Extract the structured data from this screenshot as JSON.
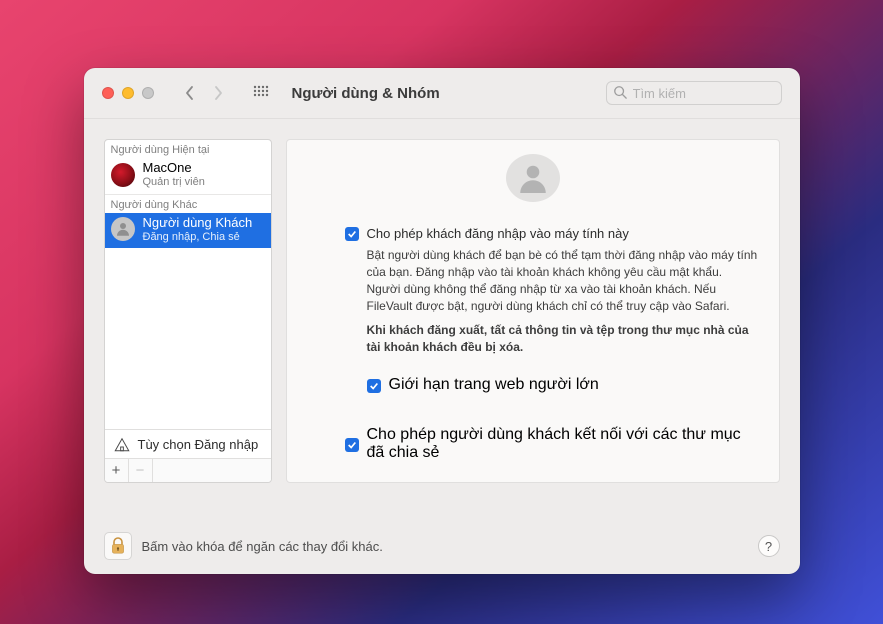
{
  "titlebar": {
    "title": "Người dùng & Nhóm",
    "search_placeholder": "Tìm kiếm"
  },
  "sidebar": {
    "section_current": "Người dùng Hiện tại",
    "section_other": "Người dùng Khác",
    "current_user": {
      "name": "MacOne",
      "role": "Quản trị viên"
    },
    "guest_user": {
      "name": "Người dùng Khách",
      "role": "Đăng nhập, Chia sẻ"
    },
    "login_options": "Tùy chọn Đăng nhập",
    "add": "+",
    "remove": "−"
  },
  "main": {
    "allow_guest_label": "Cho phép khách đăng nhập vào máy tính này",
    "allow_guest_desc": "Bật người dùng khách để bạn bè có thể tạm thời đăng nhập vào máy tính của bạn. Đăng nhập vào tài khoản khách không yêu cầu mật khẩu. Người dùng không thể đăng nhập từ xa vào tài khoản khách. Nếu FileVault được bật, người dùng khách chỉ có thể truy cập vào Safari.",
    "allow_guest_warn": "Khi khách đăng xuất, tất cả thông tin và tệp trong thư mục nhà của tài khoản khách đều bị xóa.",
    "limit_adult_label": "Giới hạn trang web người lớn",
    "share_folders_label": "Cho phép người dùng khách kết nối với các thư mục đã chia sẻ"
  },
  "footer": {
    "lock_text": "Bấm vào khóa để ngăn các thay đổi khác.",
    "help": "?"
  }
}
